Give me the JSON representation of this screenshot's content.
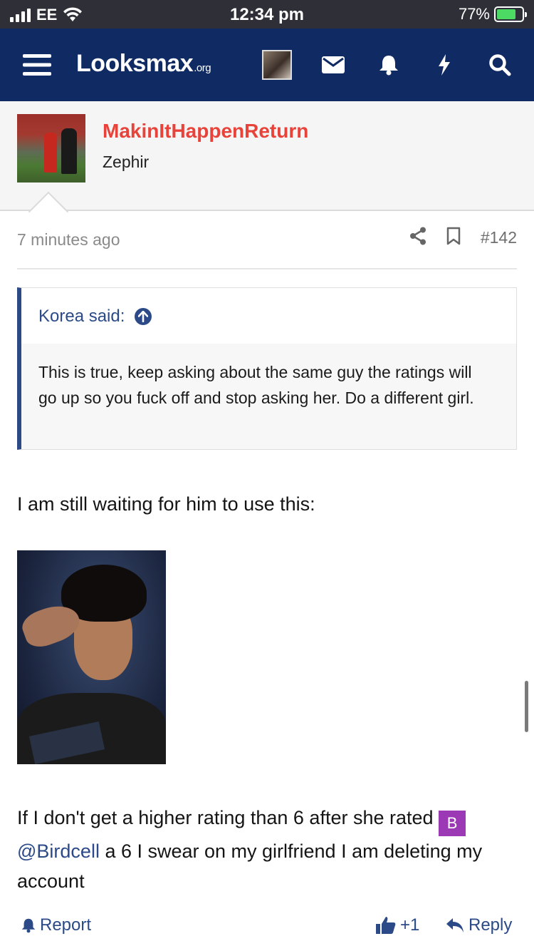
{
  "status_bar": {
    "carrier": "EE",
    "time": "12:34 pm",
    "battery_percent": "77%",
    "battery_level": 0.77,
    "battery_color": "#4cd964"
  },
  "nav": {
    "logo_main": "Looksmax",
    "logo_suffix": ".org",
    "icons": [
      "menu-icon",
      "avatar",
      "envelope-icon",
      "bell-icon",
      "bolt-icon",
      "search-icon"
    ],
    "brand_color": "#102a63"
  },
  "member": {
    "name": "MakinItHappenReturn",
    "title": "Zephir",
    "name_color": "#e8433a"
  },
  "post": {
    "time": "7 minutes ago",
    "number": "#142",
    "quote": {
      "author": "Korea said:",
      "text": "This is true, keep asking about the same guy the ratings will go up so you fuck off and stop asking her. Do a different girl."
    },
    "body_line1": "I am still waiting for him to use this:",
    "para2_before": "If I don't get a higher rating than 6 after she rated ",
    "mention_initial": "B",
    "mention": "@Birdcell",
    "para2_after": " a 6 I swear on my girlfriend I am deleting my account"
  },
  "actions": {
    "report": "Report",
    "like_count": "+1",
    "reply": "Reply"
  }
}
